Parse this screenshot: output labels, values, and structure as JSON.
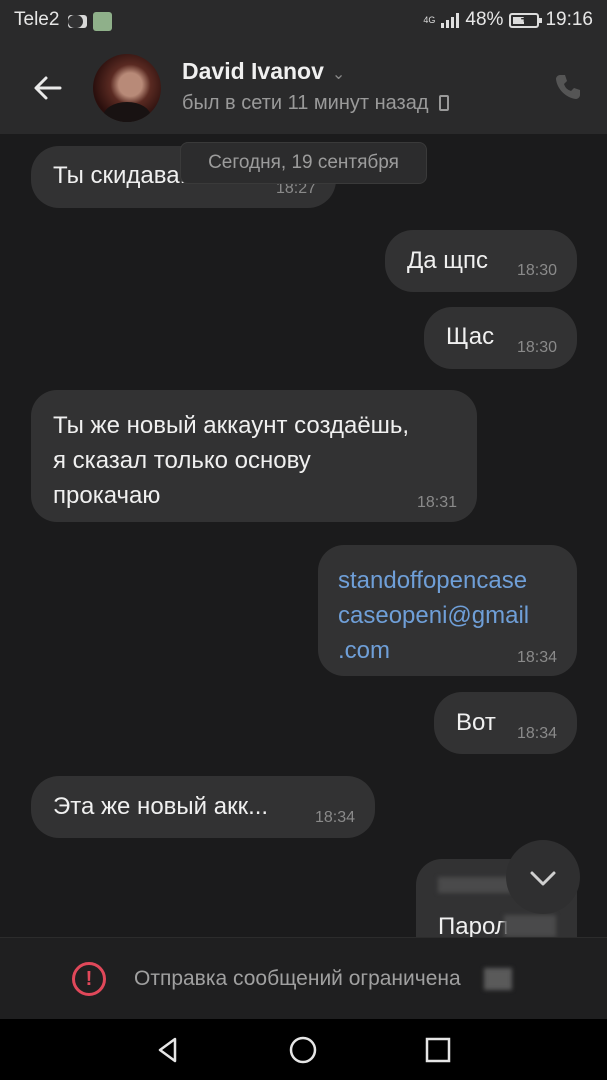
{
  "status_bar": {
    "carrier": "Tele2",
    "network": "4G",
    "battery": "48%",
    "time": "19:16",
    "battery_level": 0.48
  },
  "header": {
    "contact_name": "David Ivanov",
    "last_seen": "был в сети 11 минут назад"
  },
  "date_separator": "Сегодня, 19 сентября",
  "messages": [
    {
      "text": "Ты скидава...",
      "time": "18:27",
      "direction": "in"
    },
    {
      "text": "Да щпс",
      "time": "18:30",
      "direction": "out"
    },
    {
      "text": "Щас",
      "time": "18:30",
      "direction": "out"
    },
    {
      "lines": [
        "Ты же новый аккаунт создаёшь,",
        "я сказал только основу",
        "прокачаю"
      ],
      "time": "18:31",
      "direction": "in"
    },
    {
      "lines": [
        "standoffopencase",
        "caseopeni@gmail",
        ".com"
      ],
      "time": "18:34",
      "direction": "out",
      "is_link": true
    },
    {
      "text": "Вот",
      "time": "18:34",
      "direction": "out"
    },
    {
      "text": "Эта же новый акк...",
      "time": "18:34",
      "direction": "in"
    },
    {
      "lines": [
        "",
        "Парол"
      ],
      "direction": "out",
      "partially_hidden": true
    }
  ],
  "restriction_notice": "Отправка сообщений ограничена",
  "colors": {
    "background": "#1b1b1c",
    "bubble": "#323233",
    "link": "#6f9fd8",
    "warning": "#e0485a"
  }
}
